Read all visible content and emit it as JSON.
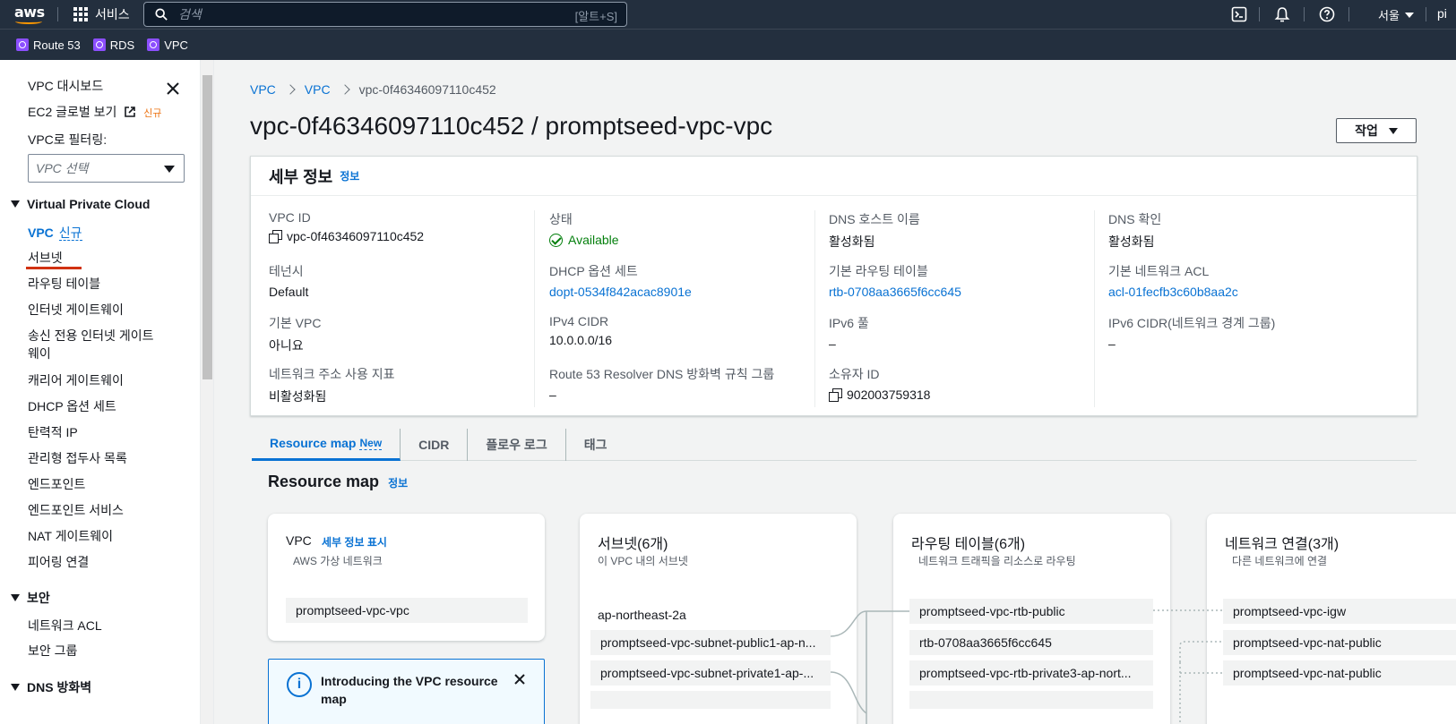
{
  "topbar": {
    "logo": "aws",
    "services_label": "서비스",
    "search_placeholder": "검색",
    "search_shortcut": "[알트+S]",
    "region": "서울",
    "user": "pi"
  },
  "favorites": [
    {
      "label": "Route 53"
    },
    {
      "label": "RDS"
    },
    {
      "label": "VPC"
    }
  ],
  "sidebar": {
    "dashboard": "VPC 대시보드",
    "ec2_global": "EC2 글로벌 보기",
    "ec2_global_new": "신규",
    "filter_label": "VPC로 필터링:",
    "filter_placeholder": "VPC 선택",
    "section_vpc": "Virtual Private Cloud",
    "vpc_item": "VPC",
    "vpc_item_new": "신규",
    "items": [
      "서브넷",
      "라우팅 테이블",
      "인터넷 게이트웨이",
      "송신 전용 인터넷 게이트",
      "웨이",
      "캐리어 게이트웨이",
      "DHCP 옵션 세트",
      "탄력적 IP",
      "관리형 접두사 목록",
      "엔드포인트",
      "엔드포인트 서비스",
      "NAT 게이트웨이",
      "피어링 연결"
    ],
    "section_security": "보안",
    "security_items": [
      "네트워크 ACL",
      "보안 그룹"
    ],
    "section_dns": "DNS 방화벽"
  },
  "breadcrumb": {
    "items": [
      "VPC",
      "VPC"
    ],
    "current": "vpc-0f46346097110c452"
  },
  "page_title": "vpc-0f46346097110c452 / promptseed-vpc-vpc",
  "actions_label": "작업",
  "details": {
    "title": "세부 정보",
    "info": "정보",
    "fields": {
      "vpc_id": {
        "k": "VPC ID",
        "v": "vpc-0f46346097110c452"
      },
      "tenancy": {
        "k": "테넌시",
        "v": "Default"
      },
      "default_vpc": {
        "k": "기본 VPC",
        "v": "아니요"
      },
      "net_usage": {
        "k": "네트워크 주소 사용 지표",
        "v": "비활성화됨"
      },
      "state": {
        "k": "상태",
        "v": "Available"
      },
      "dhcp": {
        "k": "DHCP 옵션 세트",
        "v": "dopt-0534f842acac8901e"
      },
      "ipv4": {
        "k": "IPv4 CIDR",
        "v": "10.0.0.0/16"
      },
      "route53": {
        "k": "Route 53 Resolver DNS 방화벽 규칙 그룹",
        "v": "–"
      },
      "dns_host": {
        "k": "DNS 호스트 이름",
        "v": "활성화됨"
      },
      "main_rt": {
        "k": "기본 라우팅 테이블",
        "v": "rtb-0708aa3665f6cc645"
      },
      "ipv6_pool": {
        "k": "IPv6 풀",
        "v": "–"
      },
      "owner": {
        "k": "소유자 ID",
        "v": "902003759318"
      },
      "dns_res": {
        "k": "DNS 확인",
        "v": "활성화됨"
      },
      "main_acl": {
        "k": "기본 네트워크 ACL",
        "v": "acl-01fecfb3c60b8aa2c"
      },
      "ipv6_cidr": {
        "k": "IPv6 CIDR(네트워크 경계 그룹)",
        "v": "–"
      }
    }
  },
  "tabs": [
    {
      "label": "Resource map",
      "badge": "New"
    },
    {
      "label": "CIDR"
    },
    {
      "label": "플로우 로그"
    },
    {
      "label": "태그"
    }
  ],
  "resource_map": {
    "title": "Resource map",
    "info": "정보",
    "vpc_card": {
      "title": "VPC",
      "link": "세부 정보 표시",
      "subtitle": "AWS 가상 네트워크",
      "item": "promptseed-vpc-vpc"
    },
    "notice": {
      "text": "Introducing the VPC resource map"
    },
    "subnets_card": {
      "title": "서브넷(6개)",
      "subtitle": "이 VPC 내의 서브넷",
      "az": "ap-northeast-2a",
      "items": [
        "promptseed-vpc-subnet-public1-ap-n...",
        "promptseed-vpc-subnet-private1-ap-..."
      ]
    },
    "rt_card": {
      "title": "라우팅 테이블(6개)",
      "subtitle": "네트워크 트래픽을 리소스로 라우팅",
      "items": [
        "promptseed-vpc-rtb-public",
        "rtb-0708aa3665f6cc645",
        "promptseed-vpc-rtb-private3-ap-nort..."
      ]
    },
    "conn_card": {
      "title": "네트워크 연결(3개)",
      "subtitle": "다른 네트워크에 연결",
      "items": [
        "promptseed-vpc-igw",
        "promptseed-vpc-nat-public",
        "promptseed-vpc-nat-public"
      ]
    }
  },
  "colors": {
    "topbar": "#232f3e",
    "link": "#0972d3",
    "success": "#037f0c",
    "new_badge": "#ec7211",
    "annotation_underline": "#d13212"
  }
}
